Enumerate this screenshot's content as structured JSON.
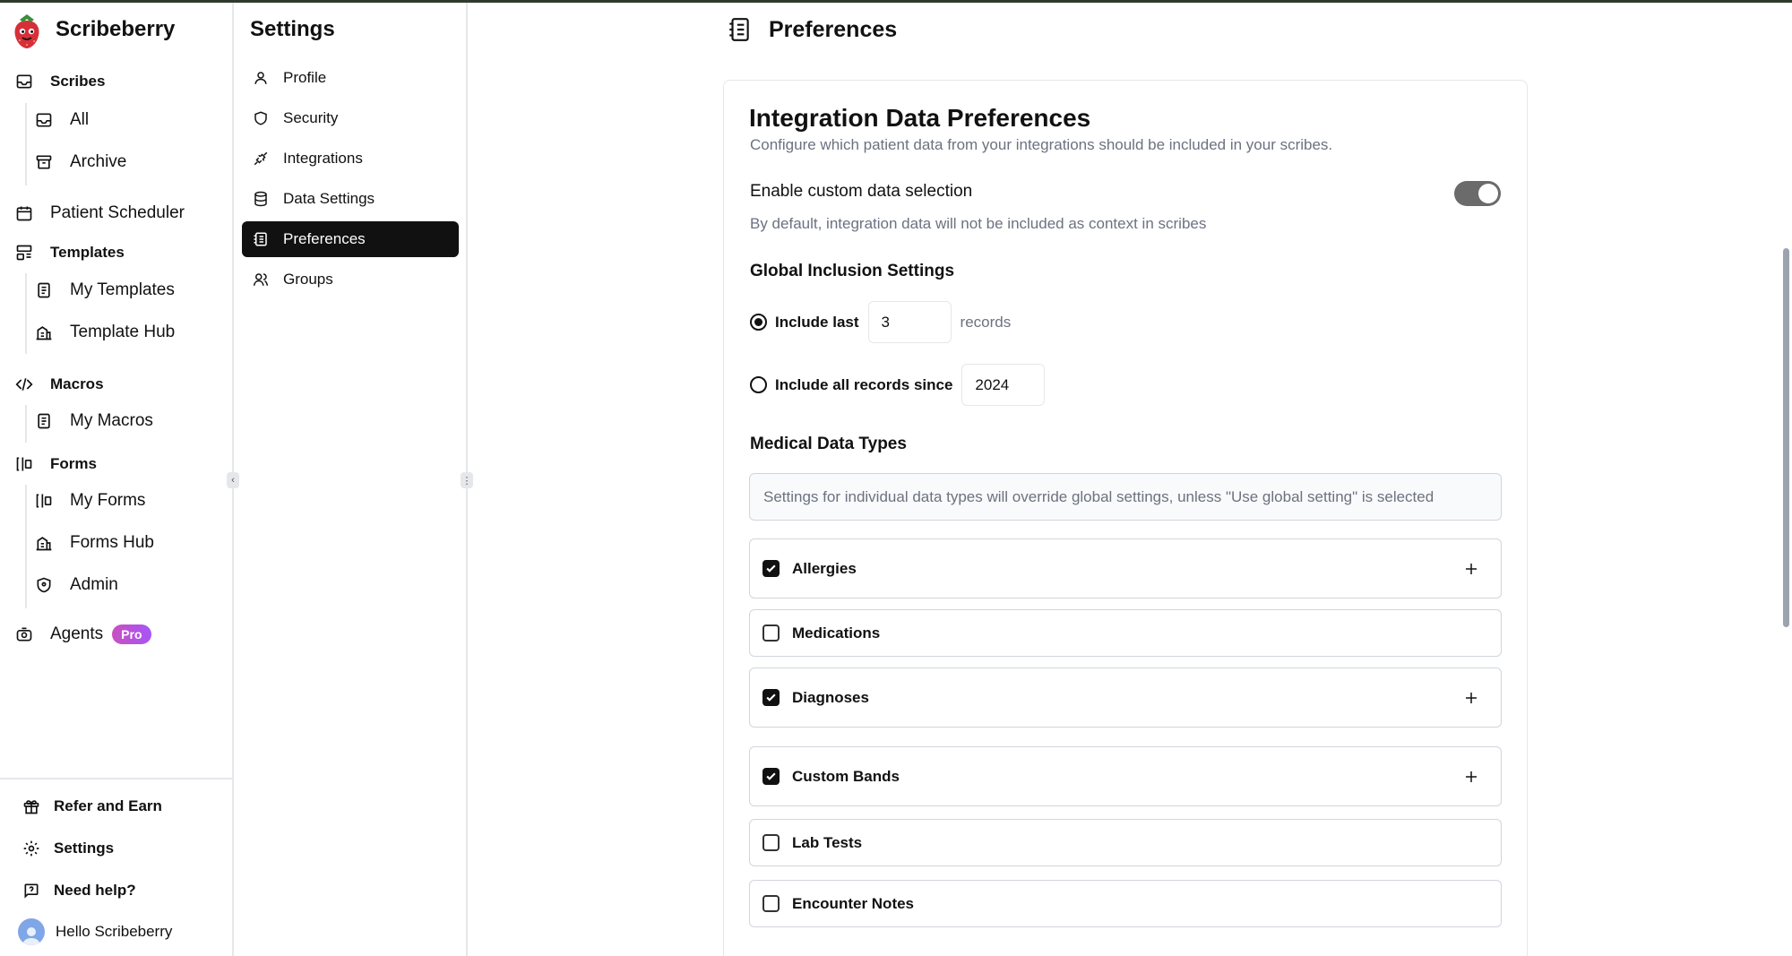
{
  "app": {
    "name": "Scribeberry"
  },
  "sidebar": {
    "scribes": {
      "label": "Scribes",
      "items": [
        {
          "label": "All"
        },
        {
          "label": "Archive"
        }
      ]
    },
    "patient_scheduler": {
      "label": "Patient Scheduler"
    },
    "templates": {
      "label": "Templates",
      "items": [
        {
          "label": "My Templates"
        },
        {
          "label": "Template Hub"
        }
      ]
    },
    "macros": {
      "label": "Macros",
      "items": [
        {
          "label": "My Macros"
        }
      ]
    },
    "forms": {
      "label": "Forms",
      "items": [
        {
          "label": "My Forms"
        },
        {
          "label": "Forms Hub"
        },
        {
          "label": "Admin"
        }
      ]
    },
    "agents": {
      "label": "Agents",
      "badge": "Pro"
    },
    "footer": {
      "refer": "Refer and Earn",
      "settings": "Settings",
      "help": "Need help?",
      "user": "Hello Scribeberry"
    }
  },
  "settings_nav": {
    "title": "Settings",
    "items": [
      {
        "label": "Profile"
      },
      {
        "label": "Security"
      },
      {
        "label": "Integrations"
      },
      {
        "label": "Data Settings"
      },
      {
        "label": "Preferences",
        "active": true
      },
      {
        "label": "Groups"
      }
    ]
  },
  "page": {
    "title": "Preferences"
  },
  "card": {
    "title": "Integration Data Preferences",
    "subtitle": "Configure which patient data from your integrations should be included in your scribes.",
    "custom_selection": {
      "label": "Enable custom data selection",
      "enabled": true,
      "help": "By default, integration data will not be included as context in scribes"
    },
    "global": {
      "heading": "Global Inclusion Settings",
      "include_last": {
        "label": "Include last",
        "value": "3",
        "suffix": "records",
        "selected": true
      },
      "include_since": {
        "label": "Include all records since",
        "value": "2024",
        "selected": false
      }
    },
    "medical": {
      "heading": "Medical Data Types",
      "info": "Settings for individual data types will override global settings, unless \"Use global setting\" is selected",
      "types": [
        {
          "label": "Allergies",
          "checked": true,
          "expandable": true
        },
        {
          "label": "Medications",
          "checked": false,
          "expandable": false
        },
        {
          "label": "Diagnoses",
          "checked": true,
          "expandable": true
        },
        {
          "label": "Custom Bands",
          "checked": true,
          "expandable": true
        },
        {
          "label": "Lab Tests",
          "checked": false,
          "expandable": false
        },
        {
          "label": "Encounter Notes",
          "checked": false,
          "expandable": false
        }
      ]
    }
  },
  "colors": {
    "accent": "#111111",
    "toggle_on": "#6b6b6b",
    "pro_badge": "#b44fd6",
    "muted_text": "#6b7280"
  }
}
